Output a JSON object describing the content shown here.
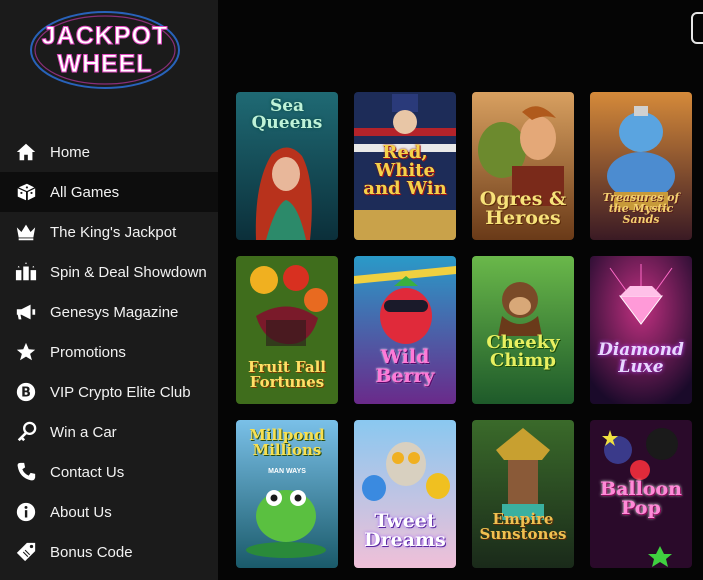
{
  "brand": {
    "line1": "JACKPOT",
    "line2": "WHEEL"
  },
  "nav": [
    {
      "label": "Home",
      "icon": "home-icon"
    },
    {
      "label": "All Games",
      "icon": "dice-icon",
      "active": true
    },
    {
      "label": "The King's Jackpot",
      "icon": "crown-icon"
    },
    {
      "label": "Spin & Deal Showdown",
      "icon": "gifts-icon"
    },
    {
      "label": "Genesys Magazine",
      "icon": "megaphone-icon"
    },
    {
      "label": "Promotions",
      "icon": "star-icon"
    },
    {
      "label": "VIP Crypto Elite Club",
      "icon": "bitcoin-icon"
    },
    {
      "label": "Win a Car",
      "icon": "car-key-icon"
    },
    {
      "label": "Contact Us",
      "icon": "phone-icon"
    },
    {
      "label": "About Us",
      "icon": "info-icon"
    },
    {
      "label": "Bonus Code",
      "icon": "tag-icon"
    }
  ],
  "games": [
    {
      "title": "Sea Queens"
    },
    {
      "title": "Red, White and Win"
    },
    {
      "title": "Ogres & Heroes"
    },
    {
      "title": "Treasures of the Mystic Sands"
    },
    {
      "title": "Fruit Fall Fortunes"
    },
    {
      "title": "Wild Berry"
    },
    {
      "title": "Cheeky Chimp"
    },
    {
      "title": "Diamond Luxe"
    },
    {
      "title": "Millpond Millions",
      "subtitle": "MAN WAYS"
    },
    {
      "title": "Tweet Dreams"
    },
    {
      "title": "Empire Sunstones"
    },
    {
      "title": "Balloon Pop"
    }
  ]
}
